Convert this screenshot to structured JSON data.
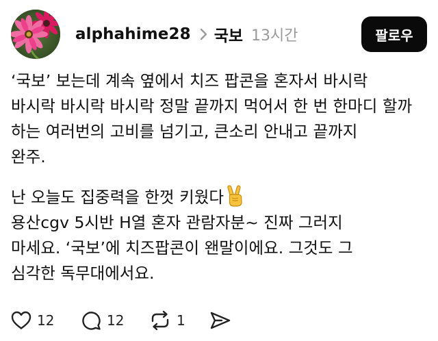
{
  "post": {
    "author": {
      "username": "alphahime28",
      "avatar_icon": "pink-gerbera-flower-avatar"
    },
    "topic": "국보",
    "time_ago": "13시간",
    "follow_label": "팔로우",
    "paragraphs": [
      {
        "lines": [
          "‘국보’ 보는데 계속 옆에서 치즈 팝콘을 혼자서 바시락",
          "바시락 바시락 바시락 정말 끝까지 먹어서 한 번 한마디 할까",
          "하는 여러번의 고비를 넘기고, 큰소리 안내고 끝까지",
          "완주."
        ]
      },
      {
        "lines": [
          "난 오늘도 집중력을 한껏 키웠다",
          "용산cgv 5시반 H열 혼자 관람자분~ 진짜 그러지",
          "마세요. ‘국보’에 치즈팝콘이 왠말이에요. 그것도 그",
          "심각한 독무대에서요."
        ]
      }
    ],
    "emoji_icon": "victory-hand-emoji",
    "actions": {
      "like_count": "12",
      "reply_count": "12",
      "repost_count": "1"
    },
    "colors": {
      "follow_button_bg": "#0a0a0a",
      "time_text": "#9a9a9a",
      "avatar_flower": "#ec3f8c"
    }
  }
}
